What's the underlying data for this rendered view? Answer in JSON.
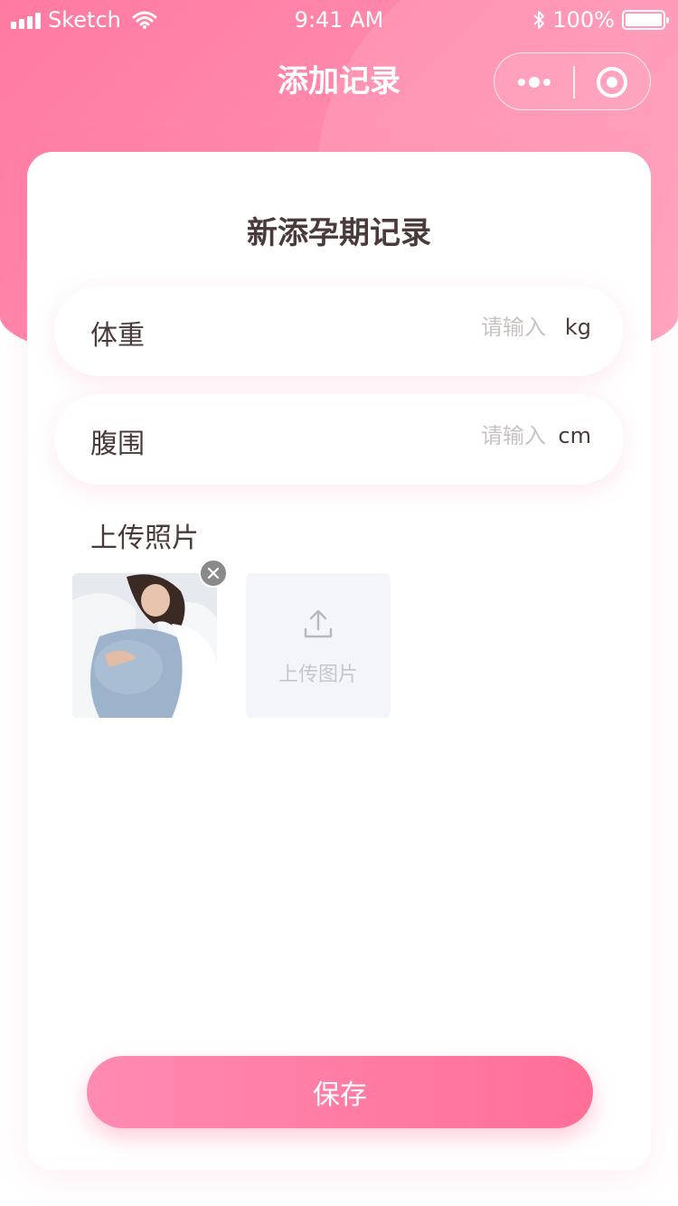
{
  "status_bar": {
    "carrier": "Sketch",
    "time": "9:41 AM",
    "battery": "100%",
    "icons": [
      "signal-icon",
      "wifi-icon",
      "bluetooth-icon",
      "battery-icon"
    ]
  },
  "nav": {
    "title": "添加记录",
    "capsule_icons": [
      "more-dots-icon",
      "target-icon"
    ]
  },
  "card": {
    "title": "新添孕期记录",
    "fields": [
      {
        "label": "体重",
        "placeholder": "请输入",
        "value": "",
        "unit": "kg"
      },
      {
        "label": "腹围",
        "placeholder": "请输入",
        "value": "",
        "unit": "cm"
      }
    ],
    "photos_label": "上传照片",
    "uploaded_photo_icon": "close-icon",
    "upload_button": {
      "label": "上传图片",
      "icon": "upload-icon"
    },
    "save_label": "保存"
  },
  "colors": {
    "brand_pink": "#ff7aa0",
    "button_gradient_start": "#ff8ab2",
    "button_gradient_end": "#ff6f98",
    "text_primary": "#4b3a3a",
    "placeholder": "#c9c2c2",
    "upload_tile_bg": "#f4f5f9"
  }
}
